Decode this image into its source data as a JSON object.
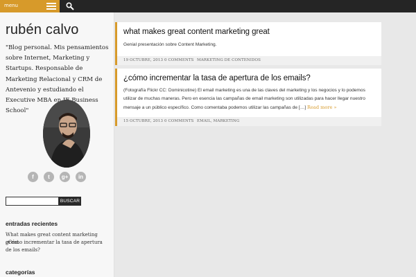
{
  "topbar": {
    "menu_label": "menu"
  },
  "sidebar": {
    "site_title": "rubén calvo",
    "description": "\"Blog personal. Mis pensamientos sobre Internet, Marketing y Startups. Responsable de Marketing Relacional y CRM de Antevenio y estudiando el Executive MBA en IE Business School\"",
    "social": [
      "f",
      "t",
      "g+",
      "in"
    ],
    "search": {
      "placeholder": "",
      "button_label": "BUSCAR"
    },
    "recent_title": "entradas recientes",
    "recent": [
      "What makes great content marketing great",
      "¿Cómo incrementar la tasa de apertura de los emails?"
    ],
    "categories_title": "categorías"
  },
  "posts": [
    {
      "title": "what makes great content marketing great",
      "excerpt": "Genial presentación sobre Content Marketing.",
      "date": "19 octubre, 2013",
      "comments": "0 Comments",
      "category": "Marketing de contenidos"
    },
    {
      "title": "¿cómo incrementar la tasa de apertura de los emails?",
      "excerpt": "(Fotografía Flickr CC: Dominicotine) El email marketing es una de las claves del marketing y los negocios y lo podemos utilizar de muchas maneras. Pero en esencia las campañas de email marketing son utilizadas para hacer llegar nuestro mensaje a un público específico. Como comentaba podemos utilizar las campañas de […]",
      "read_more": "Read more »",
      "date": "15 octubre, 2013",
      "comments": "0 Comments",
      "category": "Email, Marketing"
    }
  ],
  "colors": {
    "accent": "#d79a2a",
    "topbar": "#252525",
    "sidebar": "#f7f7f7",
    "background": "#e8e8e8"
  }
}
